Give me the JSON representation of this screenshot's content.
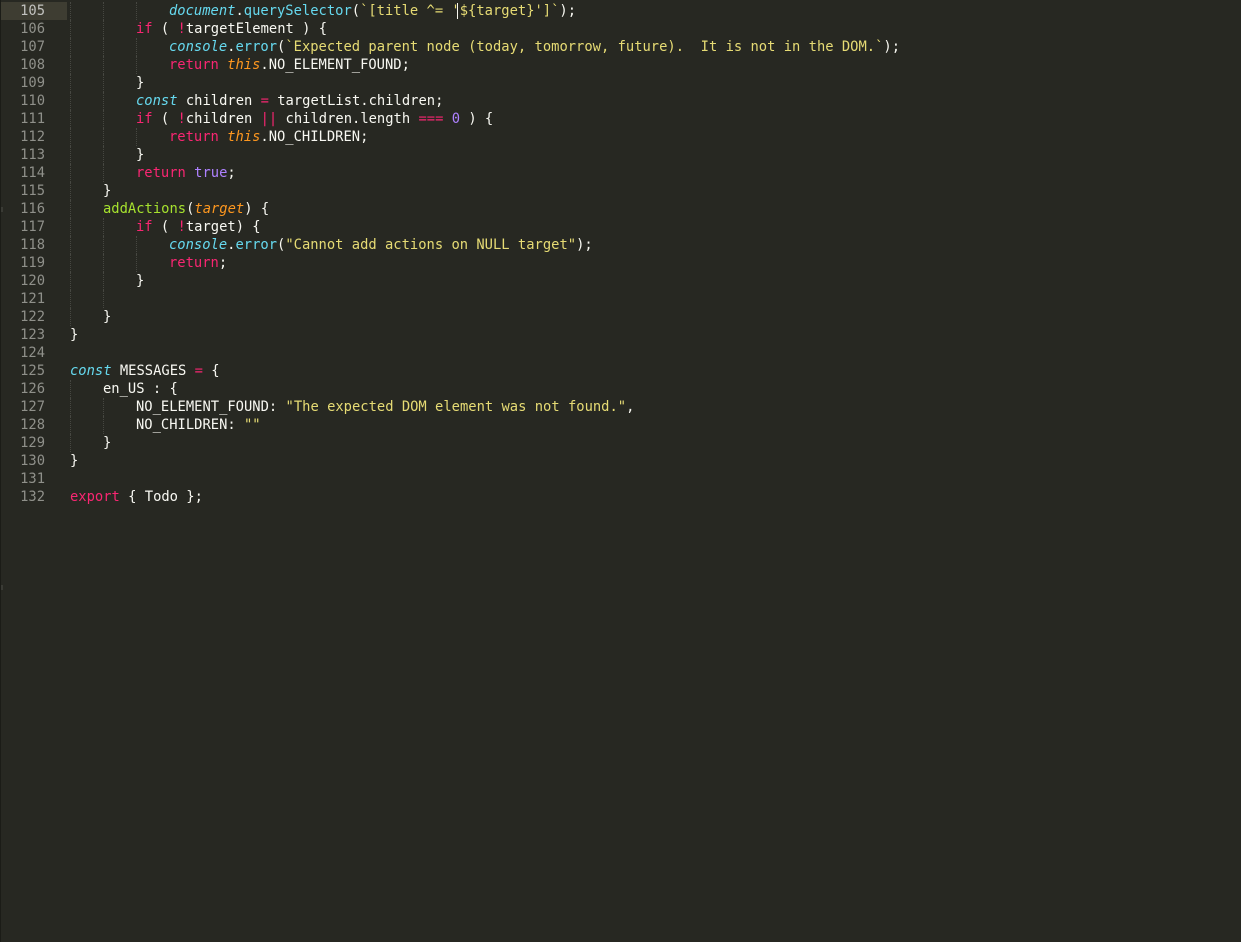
{
  "editor": {
    "current_line": "105",
    "lines": [
      {
        "n": "105",
        "indent": 3,
        "tokens": [
          {
            "t": "document",
            "c": "t-st"
          },
          {
            "t": ".",
            "c": "t-pl"
          },
          {
            "t": "querySelector",
            "c": "t-fn"
          },
          {
            "t": "(",
            "c": "t-pl"
          },
          {
            "t": "`[title ^= '${target}']`",
            "c": "t-str"
          },
          {
            "t": ");",
            "c": "t-pl"
          }
        ]
      },
      {
        "n": "106",
        "indent": 2,
        "tokens": [
          {
            "t": "if",
            "c": "t-kw"
          },
          {
            "t": " ( ",
            "c": "t-pl"
          },
          {
            "t": "!",
            "c": "t-kw"
          },
          {
            "t": "targetElement ) {",
            "c": "t-pl"
          }
        ]
      },
      {
        "n": "107",
        "indent": 3,
        "tokens": [
          {
            "t": "console",
            "c": "t-st"
          },
          {
            "t": ".",
            "c": "t-pl"
          },
          {
            "t": "error",
            "c": "t-fn"
          },
          {
            "t": "(",
            "c": "t-pl"
          },
          {
            "t": "`Expected parent node (today, tomorrow, future).  It is not in the DOM.`",
            "c": "t-str"
          },
          {
            "t": ");",
            "c": "t-pl"
          }
        ]
      },
      {
        "n": "108",
        "indent": 3,
        "tokens": [
          {
            "t": "return",
            "c": "t-kw"
          },
          {
            "t": " ",
            "c": "t-pl"
          },
          {
            "t": "this",
            "c": "t-this"
          },
          {
            "t": ".NO_ELEMENT_FOUND;",
            "c": "t-pl"
          }
        ]
      },
      {
        "n": "109",
        "indent": 2,
        "tokens": [
          {
            "t": "}",
            "c": "t-pl"
          }
        ]
      },
      {
        "n": "110",
        "indent": 2,
        "tokens": [
          {
            "t": "const",
            "c": "t-st"
          },
          {
            "t": " children ",
            "c": "t-pl"
          },
          {
            "t": "=",
            "c": "t-kw"
          },
          {
            "t": " targetList.children;",
            "c": "t-pl"
          }
        ]
      },
      {
        "n": "111",
        "indent": 2,
        "tokens": [
          {
            "t": "if",
            "c": "t-kw"
          },
          {
            "t": " ( ",
            "c": "t-pl"
          },
          {
            "t": "!",
            "c": "t-kw"
          },
          {
            "t": "children ",
            "c": "t-pl"
          },
          {
            "t": "||",
            "c": "t-kw"
          },
          {
            "t": " children.length ",
            "c": "t-pl"
          },
          {
            "t": "===",
            "c": "t-kw"
          },
          {
            "t": " ",
            "c": "t-pl"
          },
          {
            "t": "0",
            "c": "t-num"
          },
          {
            "t": " ) {",
            "c": "t-pl"
          }
        ]
      },
      {
        "n": "112",
        "indent": 3,
        "tokens": [
          {
            "t": "return",
            "c": "t-kw"
          },
          {
            "t": " ",
            "c": "t-pl"
          },
          {
            "t": "this",
            "c": "t-this"
          },
          {
            "t": ".NO_CHILDREN;",
            "c": "t-pl"
          }
        ]
      },
      {
        "n": "113",
        "indent": 2,
        "tokens": [
          {
            "t": "}",
            "c": "t-pl"
          }
        ]
      },
      {
        "n": "114",
        "indent": 2,
        "tokens": [
          {
            "t": "return",
            "c": "t-kw"
          },
          {
            "t": " ",
            "c": "t-pl"
          },
          {
            "t": "true",
            "c": "t-num"
          },
          {
            "t": ";",
            "c": "t-pl"
          }
        ]
      },
      {
        "n": "115",
        "indent": 1,
        "tokens": [
          {
            "t": "}",
            "c": "t-pl"
          }
        ]
      },
      {
        "n": "116",
        "indent": 1,
        "tokens": [
          {
            "t": "addActions",
            "c": "t-def"
          },
          {
            "t": "(",
            "c": "t-pl"
          },
          {
            "t": "target",
            "c": "t-param"
          },
          {
            "t": ") {",
            "c": "t-pl"
          }
        ]
      },
      {
        "n": "117",
        "indent": 2,
        "tokens": [
          {
            "t": "if",
            "c": "t-kw"
          },
          {
            "t": " ( ",
            "c": "t-pl"
          },
          {
            "t": "!",
            "c": "t-kw"
          },
          {
            "t": "target) {",
            "c": "t-pl"
          }
        ]
      },
      {
        "n": "118",
        "indent": 3,
        "tokens": [
          {
            "t": "console",
            "c": "t-st"
          },
          {
            "t": ".",
            "c": "t-pl"
          },
          {
            "t": "error",
            "c": "t-fn"
          },
          {
            "t": "(",
            "c": "t-pl"
          },
          {
            "t": "\"Cannot add actions on NULL target\"",
            "c": "t-str"
          },
          {
            "t": ");",
            "c": "t-pl"
          }
        ]
      },
      {
        "n": "119",
        "indent": 3,
        "tokens": [
          {
            "t": "return",
            "c": "t-kw"
          },
          {
            "t": ";",
            "c": "t-pl"
          }
        ]
      },
      {
        "n": "120",
        "indent": 2,
        "tokens": [
          {
            "t": "}",
            "c": "t-pl"
          }
        ]
      },
      {
        "n": "121",
        "indent": 0,
        "guides": 2,
        "tokens": []
      },
      {
        "n": "122",
        "indent": 1,
        "tokens": [
          {
            "t": "}",
            "c": "t-pl"
          }
        ]
      },
      {
        "n": "123",
        "indent": 0,
        "tokens": [
          {
            "t": "}",
            "c": "t-pl"
          }
        ]
      },
      {
        "n": "124",
        "indent": 0,
        "tokens": []
      },
      {
        "n": "125",
        "indent": 0,
        "tokens": [
          {
            "t": "const",
            "c": "t-st"
          },
          {
            "t": " MESSAGES ",
            "c": "t-pl"
          },
          {
            "t": "=",
            "c": "t-kw"
          },
          {
            "t": " {",
            "c": "t-pl"
          }
        ]
      },
      {
        "n": "126",
        "indent": 1,
        "tokens": [
          {
            "t": "en_US : {",
            "c": "t-pl"
          }
        ]
      },
      {
        "n": "127",
        "indent": 2,
        "tokens": [
          {
            "t": "NO_ELEMENT_FOUND: ",
            "c": "t-pl"
          },
          {
            "t": "\"The expected DOM element was not found.\"",
            "c": "t-str"
          },
          {
            "t": ",",
            "c": "t-pl"
          }
        ]
      },
      {
        "n": "128",
        "indent": 2,
        "tokens": [
          {
            "t": "NO_CHILDREN: ",
            "c": "t-pl"
          },
          {
            "t": "\"\"",
            "c": "t-str"
          }
        ]
      },
      {
        "n": "129",
        "indent": 1,
        "tokens": [
          {
            "t": "}",
            "c": "t-pl"
          }
        ]
      },
      {
        "n": "130",
        "indent": 0,
        "tokens": [
          {
            "t": "}",
            "c": "t-pl"
          }
        ]
      },
      {
        "n": "131",
        "indent": 0,
        "tokens": []
      },
      {
        "n": "132",
        "indent": 0,
        "tokens": [
          {
            "t": "export",
            "c": "t-kw"
          },
          {
            "t": " { Todo };",
            "c": "t-pl"
          }
        ]
      }
    ]
  },
  "colors": {
    "background": "#272822",
    "keyword": "#f92672",
    "storage": "#66d9ef",
    "string": "#e6db74",
    "number": "#ae81ff",
    "function_def": "#a6e22e",
    "parameter": "#fd971f"
  }
}
